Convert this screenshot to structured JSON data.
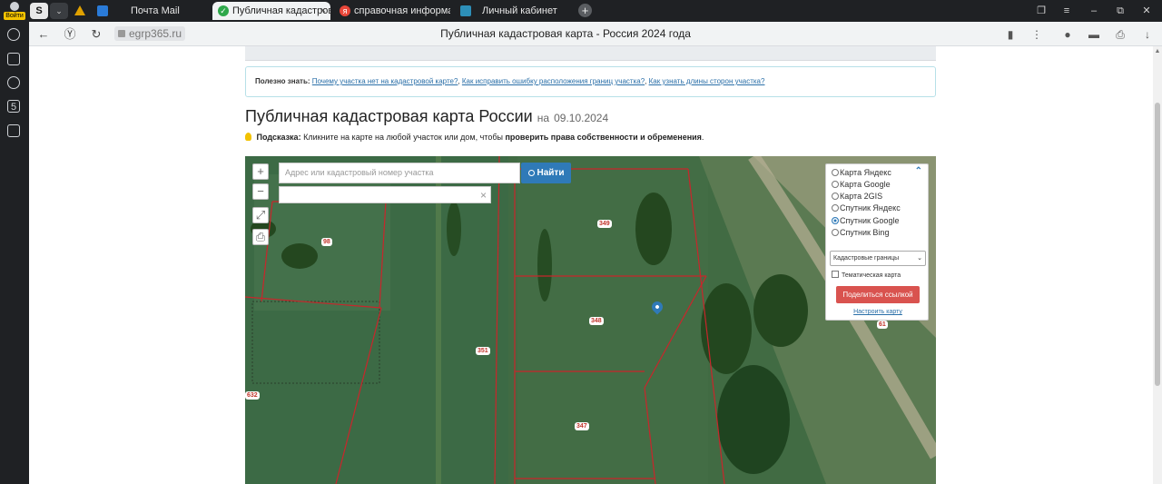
{
  "browser": {
    "login_badge": "Войти",
    "tabs": [
      {
        "title": "Почта Mail",
        "active": false
      },
      {
        "title": "Публичная кадастровая",
        "active": true,
        "close": "×"
      },
      {
        "title": "справочная информация",
        "active": false,
        "favicon_letter": "я"
      },
      {
        "title": "Личный кабинет",
        "active": false
      }
    ],
    "new_tab": "+",
    "tab_s_letter": "S",
    "address": {
      "domain": "egrp365.ru",
      "page_title": "Публичная кадастровая карта - Россия 2024 года"
    },
    "accent": "#2f7ab8"
  },
  "sidebar": {
    "items": [
      {
        "icon": "history-icon"
      },
      {
        "icon": "notes-icon"
      },
      {
        "icon": "play-icon"
      },
      {
        "icon": "s-icon",
        "letter": "5"
      },
      {
        "icon": "screenshot-icon"
      }
    ]
  },
  "useful": {
    "prefix": "Полезно знать:",
    "links": [
      "Почему участка нет на кадастровой карте?",
      "Как исправить ошибку расположения границ участка?",
      "Как узнать длины сторон участка?"
    ]
  },
  "heading": {
    "title": "Публичная кадастровая карта России",
    "date_prefix": "на",
    "date": "09.10.2024"
  },
  "hint": {
    "label": "Подсказка:",
    "text": "Кликните на карте на любой участок или дом, чтобы",
    "bold": "проверить права собственности и обременения",
    "end": "."
  },
  "map": {
    "search_placeholder": "Адрес или кадастровый номер участка",
    "search_value": "",
    "search2_value": "",
    "clear": "×",
    "find_button": "Найти",
    "zoom_in": "+",
    "zoom_out": "−",
    "plot_labels": [
      "349",
      "98",
      "348",
      "351",
      "347",
      "632",
      "61"
    ],
    "layers": {
      "options": [
        {
          "label": "Карта Яндекс",
          "selected": false
        },
        {
          "label": "Карта Google",
          "selected": false
        },
        {
          "label": "Карта 2GIS",
          "selected": false
        },
        {
          "label": "Спутник Яндекс",
          "selected": false
        },
        {
          "label": "Спутник Google",
          "selected": true
        },
        {
          "label": "Спутник Bing",
          "selected": false
        }
      ],
      "select_value": "Кадастровые границы",
      "thematic_label": "Тематическая карта",
      "thematic_checked": false,
      "share_button": "Поделиться ссылкой",
      "setup_link": "Настроить карту"
    },
    "colors": {
      "boundary": "#c8262b",
      "share_button": "#d9534f",
      "find_button": "#2f7ab8"
    }
  }
}
